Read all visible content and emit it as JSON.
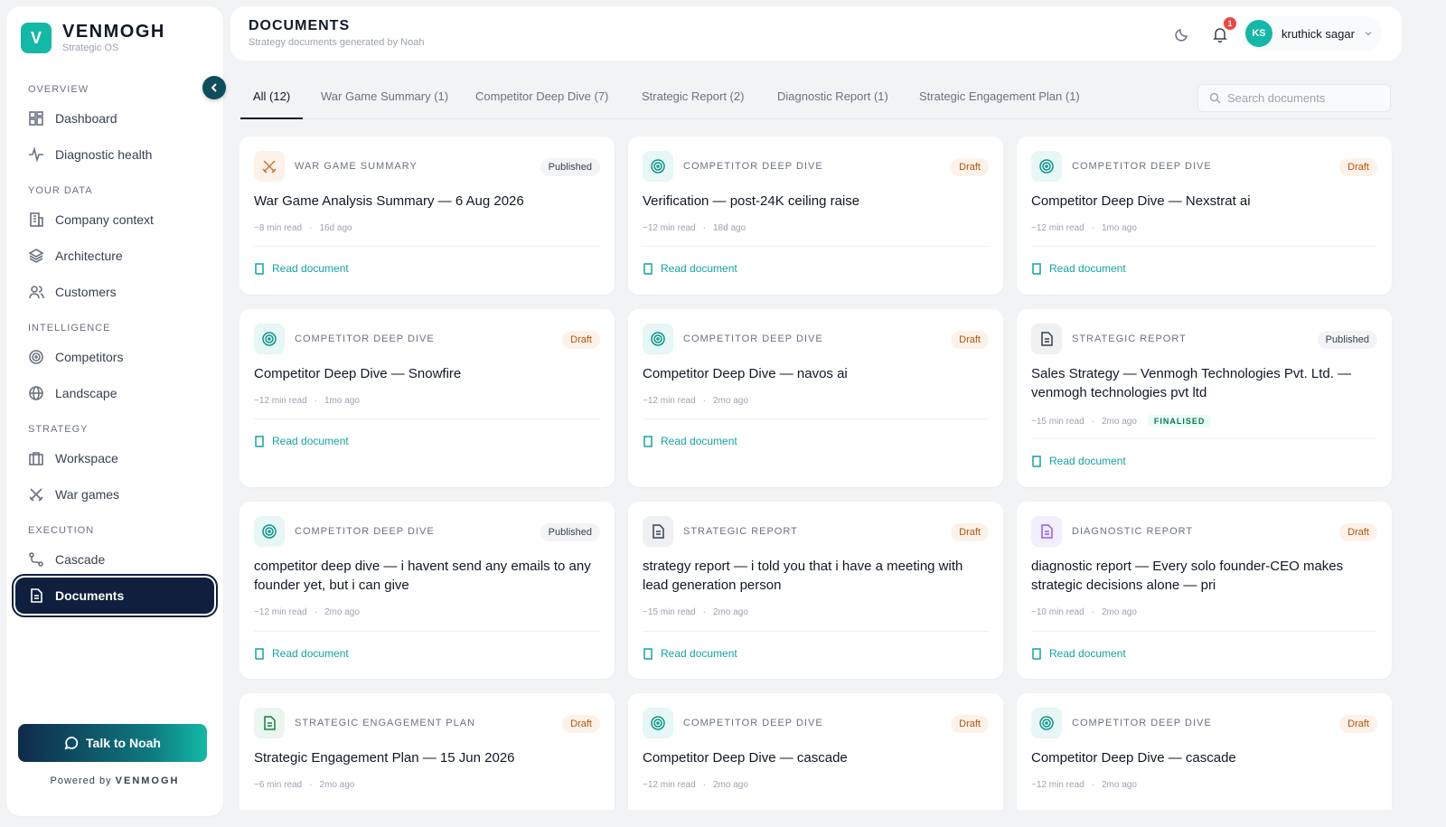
{
  "brand": {
    "name": "VENMOGH",
    "subtitle": "Strategic OS",
    "logo_letter": "V"
  },
  "sidebar": {
    "sections": [
      {
        "label": "OVERVIEW",
        "items": [
          {
            "label": "Dashboard",
            "icon": "dashboard-icon"
          },
          {
            "label": "Diagnostic health",
            "icon": "pulse-icon"
          }
        ]
      },
      {
        "label": "YOUR DATA",
        "items": [
          {
            "label": "Company context",
            "icon": "building-icon"
          },
          {
            "label": "Architecture",
            "icon": "layers-icon"
          },
          {
            "label": "Customers",
            "icon": "users-icon"
          }
        ]
      },
      {
        "label": "INTELLIGENCE",
        "items": [
          {
            "label": "Competitors",
            "icon": "target-icon"
          },
          {
            "label": "Landscape",
            "icon": "globe-icon"
          }
        ]
      },
      {
        "label": "STRATEGY",
        "items": [
          {
            "label": "Workspace",
            "icon": "briefcase-icon"
          },
          {
            "label": "War games",
            "icon": "swords-icon"
          }
        ]
      },
      {
        "label": "EXECUTION",
        "items": [
          {
            "label": "Cascade",
            "icon": "route-icon"
          },
          {
            "label": "Documents",
            "icon": "document-icon",
            "active": true
          }
        ]
      }
    ],
    "talk_button": "Talk to Noah",
    "powered_prefix": "Powered by",
    "powered_brand": "VENMOGH"
  },
  "header": {
    "title": "DOCUMENTS",
    "subtitle": "Strategy documents generated by Noah",
    "notifications": "1",
    "user_initials": "KS",
    "user_name": "kruthick sagar"
  },
  "tabs": [
    "All (12)",
    "War Game Summary (1)",
    "Competitor Deep Dive (7)",
    "Strategic Report (2)",
    "Diagnostic Report (1)",
    "Strategic Engagement Plan (1)"
  ],
  "search": {
    "placeholder": "Search documents"
  },
  "read_label": "Read document",
  "colors": {
    "accent": "#14b8a6",
    "nav_active": "#0f1f3d",
    "draft_bg": "#fdf2e9",
    "draft_text": "#b45309"
  },
  "cards": [
    {
      "type": "WAR GAME SUMMARY",
      "status": "Published",
      "title": "War Game Analysis Summary — 6 Aug 2026",
      "read_time": "~8 min read",
      "age": "16d ago",
      "icon": "swords-icon"
    },
    {
      "type": "COMPETITOR DEEP DIVE",
      "status": "Draft",
      "title": "Verification — post-24K ceiling raise",
      "read_time": "~12 min read",
      "age": "18d ago",
      "icon": "target-icon"
    },
    {
      "type": "COMPETITOR DEEP DIVE",
      "status": "Draft",
      "title": "Competitor Deep Dive — Nexstrat ai",
      "read_time": "~12 min read",
      "age": "1mo ago",
      "icon": "target-icon"
    },
    {
      "type": "COMPETITOR DEEP DIVE",
      "status": "Draft",
      "title": "Competitor Deep Dive — Snowfire",
      "read_time": "~12 min read",
      "age": "1mo ago",
      "icon": "target-icon"
    },
    {
      "type": "COMPETITOR DEEP DIVE",
      "status": "Draft",
      "title": "Competitor Deep Dive — navos ai",
      "read_time": "~12 min read",
      "age": "2mo ago",
      "icon": "target-icon"
    },
    {
      "type": "STRATEGIC REPORT",
      "status": "Published",
      "title": "Sales Strategy — Venmogh Technologies Pvt. Ltd. — venmogh technologies pvt ltd",
      "read_time": "~15 min read",
      "age": "2mo ago",
      "tag": "FINALISED",
      "icon": "report-icon"
    },
    {
      "type": "COMPETITOR DEEP DIVE",
      "status": "Published",
      "title": "competitor deep dive — i havent send any emails to any founder yet, but i can give",
      "read_time": "~12 min read",
      "age": "2mo ago",
      "icon": "target-icon"
    },
    {
      "type": "STRATEGIC REPORT",
      "status": "Draft",
      "title": "strategy report — i told you that i have a meeting with lead generation person",
      "read_time": "~15 min read",
      "age": "2mo ago",
      "icon": "report-icon"
    },
    {
      "type": "DIAGNOSTIC REPORT",
      "status": "Draft",
      "title": "diagnostic report — Every solo founder-CEO makes strategic decisions alone — pri",
      "read_time": "~10 min read",
      "age": "2mo ago",
      "icon": "diagnostic-icon"
    },
    {
      "type": "STRATEGIC ENGAGEMENT PLAN",
      "status": "Draft",
      "title": "Strategic Engagement Plan — 15 Jun 2026",
      "read_time": "~6 min read",
      "age": "2mo ago",
      "icon": "plan-icon"
    },
    {
      "type": "COMPETITOR DEEP DIVE",
      "status": "Draft",
      "title": "Competitor Deep Dive — cascade",
      "read_time": "~12 min read",
      "age": "2mo ago",
      "icon": "target-icon"
    },
    {
      "type": "COMPETITOR DEEP DIVE",
      "status": "Draft",
      "title": "Competitor Deep Dive — cascade",
      "read_time": "~12 min read",
      "age": "2mo ago",
      "icon": "target-icon"
    }
  ]
}
